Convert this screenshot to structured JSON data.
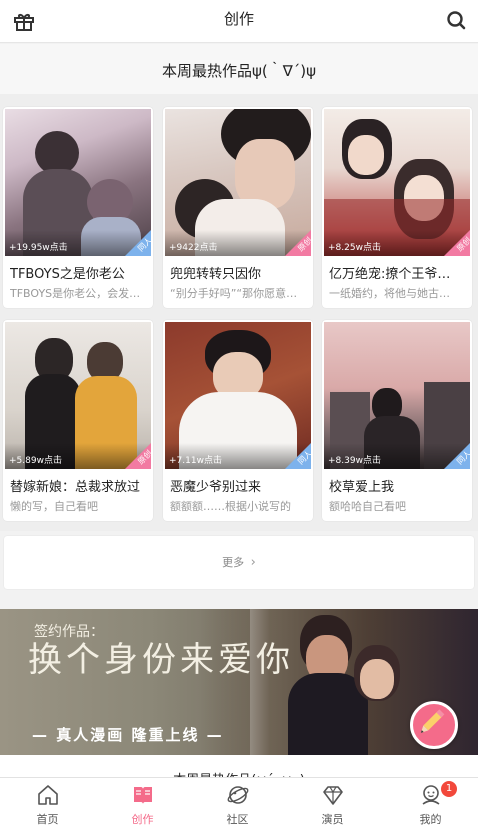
{
  "header": {
    "title": "创作",
    "left_icon": "gift-icon",
    "right_icon": "search-icon"
  },
  "section": {
    "title": "本周最热作品ψ(｀∇´)ψ"
  },
  "colors": {
    "accent": "#f46b8a",
    "ribbon_blue": "#7db2ec",
    "ribbon_pink": "#f27aa2",
    "badge": "#f2483b"
  },
  "works": [
    {
      "title": "TFBOYS之是你老公",
      "desc": "TFBOYS是你老公，会发…",
      "clicks": "+19.95w点击",
      "tag": "同人",
      "tag_color": "#7db2ec",
      "image": "couple-photo-hearts"
    },
    {
      "title": "兜兜转转只因你",
      "desc": "“别分手好吗”“那你愿意…",
      "clicks": "+9422点击",
      "tag": "原创",
      "tag_color": "#f27aa2",
      "image": "couple-closeup-photo"
    },
    {
      "title": "亿万绝宠:撩个王爷…",
      "desc": "一纸婚约，将他与她古…",
      "clicks": "+8.25w点击",
      "tag": "原创",
      "tag_color": "#f27aa2",
      "image": "ancient-style-couple-art"
    },
    {
      "title": "替嫁新娘：总裁求放过",
      "desc": "懒的写，自己看吧",
      "clicks": "+5.89w点击",
      "tag": "原创",
      "tag_color": "#f27aa2",
      "image": "couple-mirror-selfie"
    },
    {
      "title": "恶魔少爷别过来",
      "desc": "额额额……根据小说写的",
      "clicks": "+7.11w点击",
      "tag": "同人",
      "tag_color": "#7db2ec",
      "image": "boy-white-sweater"
    },
    {
      "title": "校草爱上我",
      "desc": "额哈哈自己看吧",
      "clicks": "+8.39w点击",
      "tag": "同人",
      "tag_color": "#7db2ec",
      "image": "couple-sunset-street"
    }
  ],
  "more": {
    "label": "更多"
  },
  "banner": {
    "tag": "签约作品：",
    "title": "换个身份来爱你",
    "subtitle": "— 真人漫画 隆重上线 —",
    "button_icon": "pencil-icon"
  },
  "tail": {
    "text": "本周最热作品(ω´•ω•)"
  },
  "tabs": [
    {
      "label": "首页",
      "icon": "home-icon",
      "active": false
    },
    {
      "label": "创作",
      "icon": "book-icon",
      "active": true
    },
    {
      "label": "社区",
      "icon": "planet-icon",
      "active": false
    },
    {
      "label": "演员",
      "icon": "diamond-icon",
      "active": false
    },
    {
      "label": "我的",
      "icon": "profile-icon",
      "active": false,
      "badge": "1"
    }
  ]
}
